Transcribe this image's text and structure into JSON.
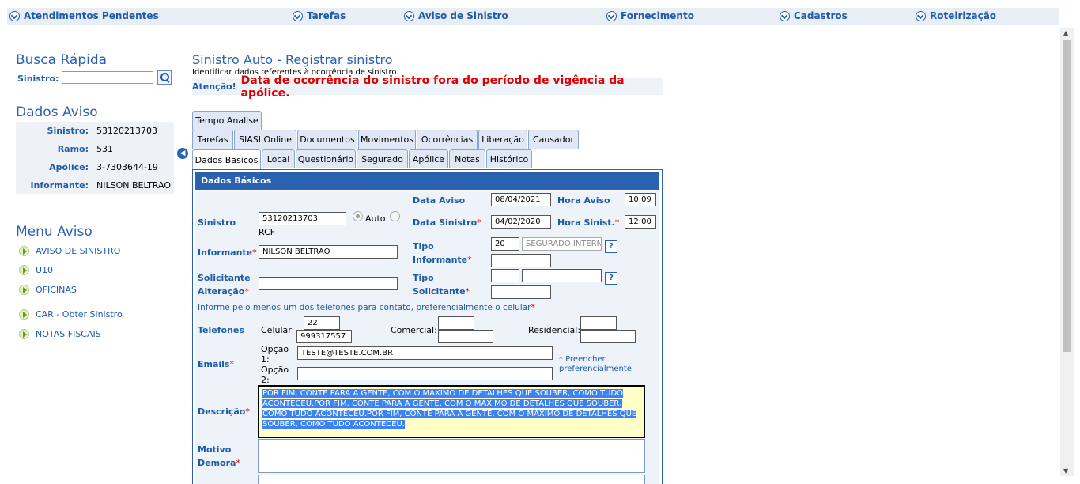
{
  "topnav": [
    "Atendimentos Pendentes",
    "Tarefas",
    "Aviso de Sinistro",
    "Fornecimento",
    "Cadastros",
    "Roteirização"
  ],
  "quick_search": {
    "title": "Busca Rápida",
    "label": "Sinistro:",
    "value": ""
  },
  "dados_aviso": {
    "title": "Dados Aviso",
    "rows": [
      {
        "label": "Sinistro:",
        "value": "53120213703"
      },
      {
        "label": "Ramo:",
        "value": "531"
      },
      {
        "label": "Apólice:",
        "value": "3-7303644-19"
      },
      {
        "label": "Informante:",
        "value": "NILSON BELTRAO"
      }
    ]
  },
  "menu_aviso": {
    "title": "Menu Aviso",
    "items": [
      "AVISO DE SINISTRO",
      "U10",
      "OFICINAS",
      "CAR - Obter Sinistro",
      "NOTAS FISCAIS"
    ]
  },
  "page": {
    "title": "Sinistro Auto - Registrar sinistro",
    "subtitle": "Identificar dados referentes à ocorrência de sinistro.",
    "alert_label": "Atenção!",
    "alert_message": "Data de ocorrência do sinistro fora do período de vigência da apólice."
  },
  "tabs": {
    "row1": [
      "Tempo Analise"
    ],
    "row2": [
      "Tarefas",
      "SIASI Online",
      "Documentos",
      "Movimentos",
      "Ocorrências",
      "Liberação",
      "Causador"
    ],
    "row3": [
      "Dados Basicos",
      "Local",
      "Questionário",
      "Segurado",
      "Apólice",
      "Notas",
      "Histórico"
    ],
    "active": "Dados Basicos"
  },
  "form": {
    "section_title": "Dados Básicos",
    "data_aviso_label": "Data Aviso",
    "data_aviso": "08/04/2021",
    "hora_aviso_label": "Hora Aviso",
    "hora_aviso": "10:09",
    "sinistro_label": "Sinistro",
    "sinistro": "53120213703",
    "sinistro_type": "RCF",
    "radio_label": "Auto",
    "data_sinistro_label": "Data Sinistro",
    "data_sinistro": "04/02/2020",
    "hora_sinistro_label": "Hora Sinist.",
    "hora_sinistro": "12:00",
    "informante_label": "Informante",
    "informante": "NILSON BELTRAO",
    "tipo_informante_label_1": "Tipo",
    "tipo_informante_label_2": "Informante",
    "tipo_informante_code": "20",
    "tipo_informante_desc": "SEGURADO INTERNE",
    "tipo_informante_extra": "",
    "solicitante_label_1": "Solicitante",
    "solicitante_label_2": "Alteração",
    "solicitante": "",
    "tipo_solicitante_label_1": "Tipo",
    "tipo_solicitante_label_2": "Solicitante",
    "tipo_solicitante_code": "",
    "tipo_solicitante_desc": "",
    "tipo_solicitante_extra": "",
    "phone_instruction": "Informe pelo menos um dos telefones para contato, preferencialmente o celular",
    "telefones_label": "Telefones",
    "celular_label": "Celular:",
    "celular_ddd": "22",
    "celular_number": "999317557",
    "comercial_label": "Comercial:",
    "comercial_ddd": "",
    "comercial_number": "",
    "residencial_label": "Residencial:",
    "residencial_ddd": "",
    "residencial_number": "",
    "emails_label": "Emails",
    "opcao1_label_1": "Opção",
    "opcao1_label_2": "1:",
    "email1": "TESTE@TESTE.COM.BR",
    "opcao2_label_1": "Opção",
    "opcao2_label_2": "2:",
    "email2": "",
    "email_note_1": "* Preencher",
    "email_note_2": "preferencialmente",
    "descricao_label": "Descrição",
    "descricao": "POR FIM, CONTE PARA A GENTE, COM O MAXIMO DE DETALHES QUE SOUBER, COMO TUDO ACONTECEU.POR FIM, CONTE PARA A GENTE, COM O MAXIMO DE DETALHES QUE SOUBER, COMO TUDO ACONTECEU.POR FIM, CONTE PARA A GENTE, COM O MAXIMO DE DETALHES QUE SOUBER, COMO TUDO ACONTECEU.",
    "motivo_label_1": "Motivo",
    "motivo_label_2": "Demora",
    "motivo": "",
    "required_mark": "*",
    "help_label": "?"
  },
  "colors": {
    "accent": "#2a62b0",
    "alert": "#e00000",
    "panel_bg": "#eef3fa",
    "highlight": "#ffffc8"
  }
}
